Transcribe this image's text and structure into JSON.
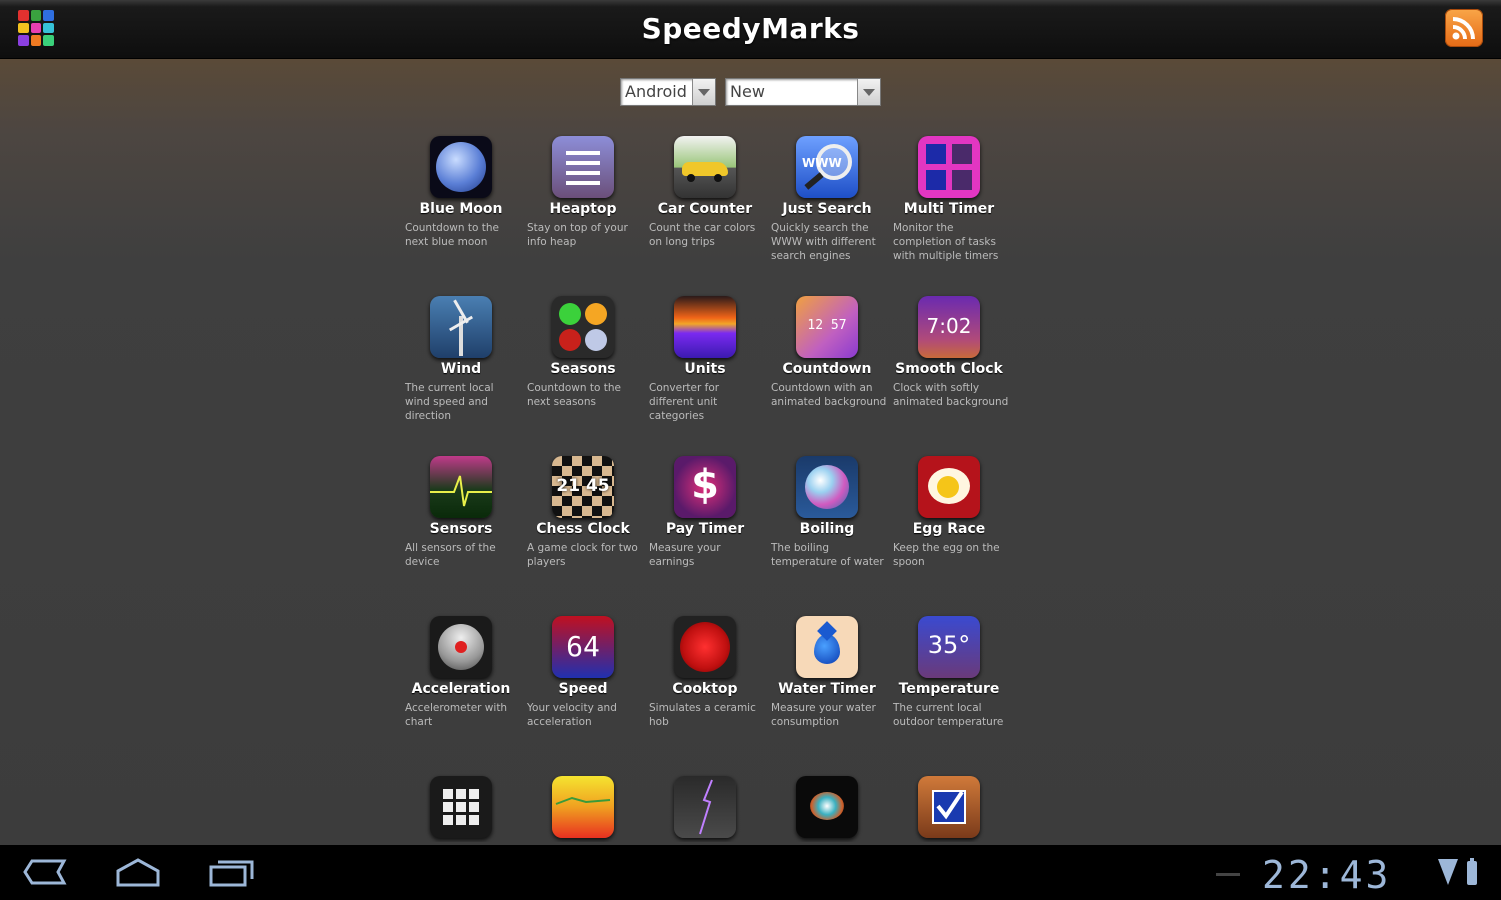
{
  "app": {
    "title": "SpeedyMarks"
  },
  "icons": {
    "menu": "app-grid-icon",
    "rss": "rss-feed-icon"
  },
  "filters": {
    "platform": "Android",
    "sort": "New"
  },
  "apps": [
    {
      "name": "Blue Moon",
      "desc": "Countdown to the next blue moon"
    },
    {
      "name": "Heaptop",
      "desc": "Stay on top of your info heap"
    },
    {
      "name": "Car Counter",
      "desc": "Count the car colors on long trips"
    },
    {
      "name": "Just Search",
      "desc": "Quickly search the WWW with different search engines"
    },
    {
      "name": "Multi Timer",
      "desc": "Monitor the completion of tasks with multiple timers"
    },
    {
      "name": "Wind",
      "desc": "The current local wind speed and direction"
    },
    {
      "name": "Seasons",
      "desc": "Countdown to the next seasons"
    },
    {
      "name": "Units",
      "desc": "Converter for different unit categories"
    },
    {
      "name": "Countdown",
      "desc": "Countdown with an animated background"
    },
    {
      "name": "Smooth Clock",
      "desc": "Clock with softly animated background"
    },
    {
      "name": "Sensors",
      "desc": "All sensors of the device"
    },
    {
      "name": "Chess Clock",
      "desc": "A game clock for two players"
    },
    {
      "name": "Pay Timer",
      "desc": "Measure your earnings"
    },
    {
      "name": "Boiling",
      "desc": "The boiling temperature of water"
    },
    {
      "name": "Egg Race",
      "desc": "Keep the egg on the spoon"
    },
    {
      "name": "Acceleration",
      "desc": "Accelerometer with chart"
    },
    {
      "name": "Speed",
      "desc": "Your velocity and acceleration"
    },
    {
      "name": "Cooktop",
      "desc": "Simulates a ceramic hob"
    },
    {
      "name": "Water Timer",
      "desc": "Measure your water consumption"
    },
    {
      "name": "Temperature",
      "desc": "The current local outdoor temperature"
    },
    {
      "name": "",
      "desc": ""
    },
    {
      "name": "",
      "desc": ""
    },
    {
      "name": "",
      "desc": ""
    },
    {
      "name": "",
      "desc": ""
    },
    {
      "name": "",
      "desc": ""
    }
  ],
  "icon_text": {
    "countdown": "12 57",
    "smooth_clock": "7:02",
    "chess_clock": "21 45",
    "pay_timer": "$",
    "speed": "64",
    "temperature": "35°",
    "just_search": "WWW"
  },
  "navbar": {
    "time": "22:43"
  }
}
